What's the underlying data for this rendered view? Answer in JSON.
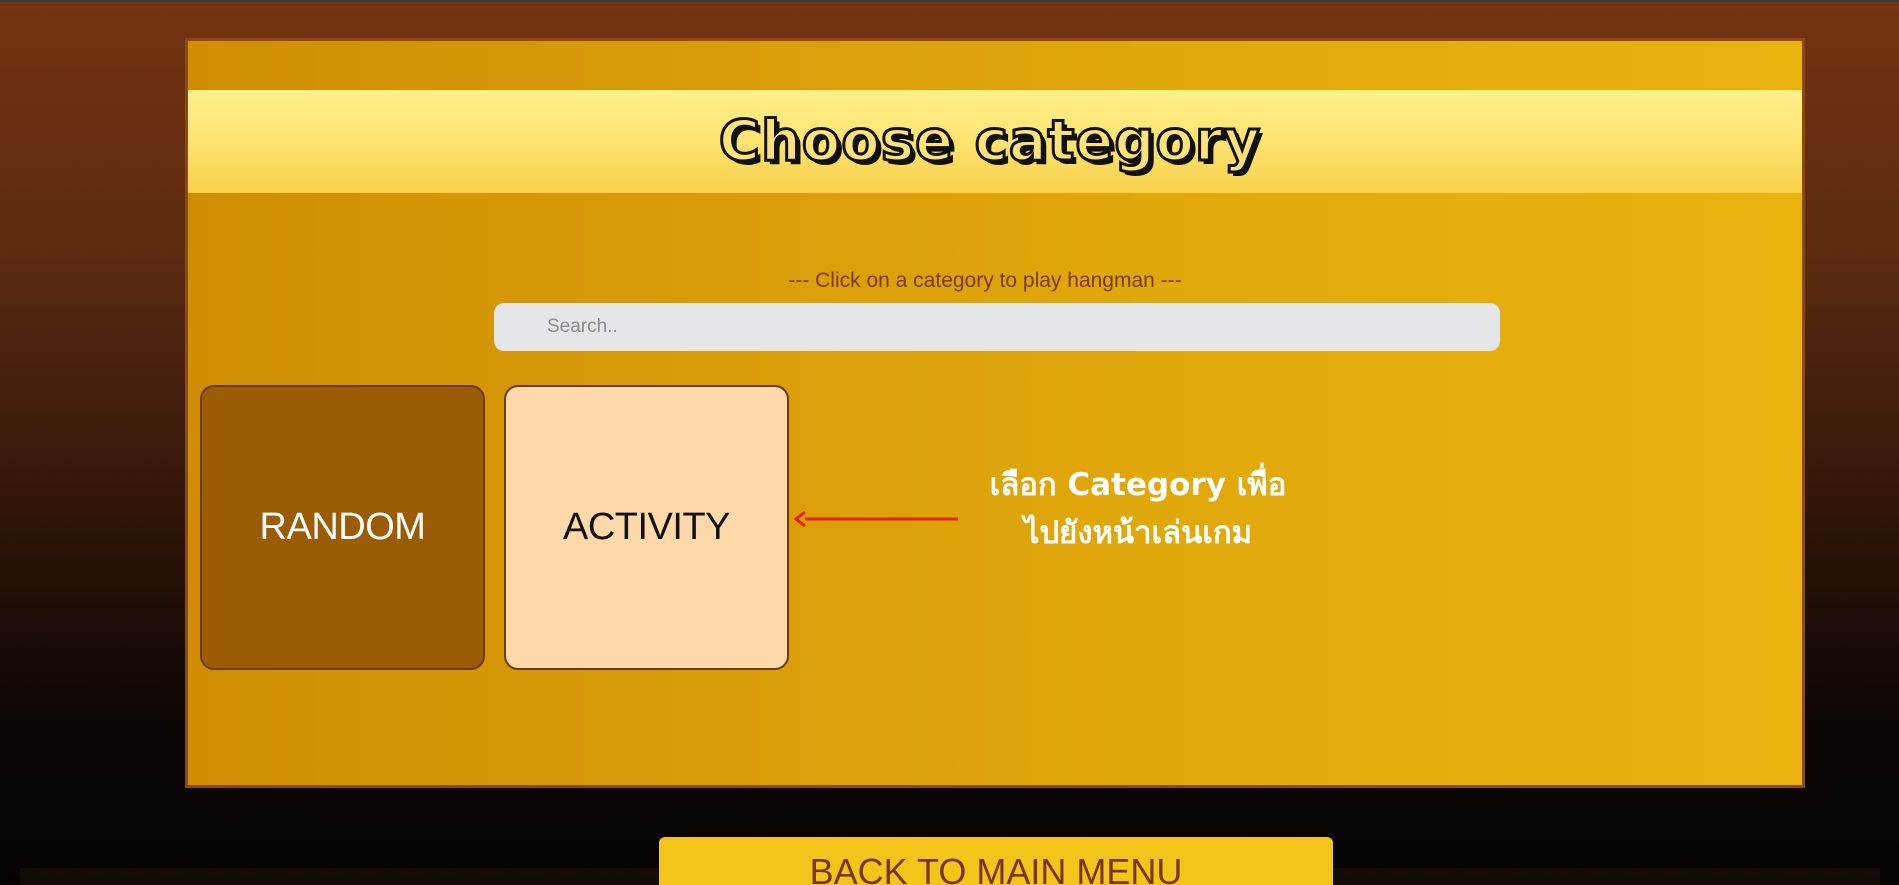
{
  "page": {
    "title": "Choose category",
    "subtitle": "--- Click on a category to play hangman ---"
  },
  "search": {
    "placeholder": "Search..",
    "value": ""
  },
  "categories": [
    {
      "label": "RANDOM",
      "color": "#9b5c05"
    },
    {
      "label": "ACTIVITY",
      "color": "#fdd8a8"
    }
  ],
  "annotation": {
    "line1": "เลือก Category เพื่อ",
    "line2": "ไปยังหน้าเล่นเกม",
    "arrow_color": "#e8231c"
  },
  "footer": {
    "back_label": "BACK TO MAIN MENU"
  },
  "colors": {
    "accent_yellow": "#f5c41a",
    "panel": "#dea00a",
    "title_band": "#fde574"
  }
}
